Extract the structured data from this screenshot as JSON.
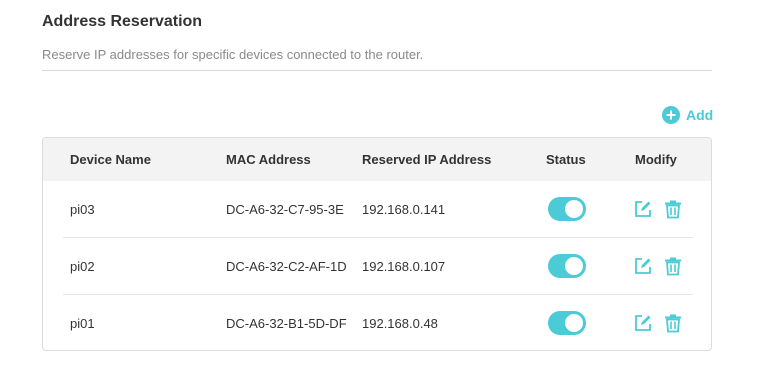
{
  "section": {
    "title": "Address Reservation",
    "description": "Reserve IP addresses for specific devices connected to the router."
  },
  "toolbar": {
    "add_label": "Add",
    "add_icon": "plus-circle-icon"
  },
  "colors": {
    "accent": "#4acbd6",
    "header_bg": "#f3f3f3"
  },
  "table": {
    "headers": {
      "device_name": "Device Name",
      "mac_address": "MAC Address",
      "reserved_ip": "Reserved IP Address",
      "status": "Status",
      "modify": "Modify"
    },
    "rows": [
      {
        "device_name": "pi03",
        "mac_address": "DC-A6-32-C7-95-3E",
        "reserved_ip": "192.168.0.141",
        "status_enabled": true
      },
      {
        "device_name": "pi02",
        "mac_address": "DC-A6-32-C2-AF-1D",
        "reserved_ip": "192.168.0.107",
        "status_enabled": true
      },
      {
        "device_name": "pi01",
        "mac_address": "DC-A6-32-B1-5D-DF",
        "reserved_ip": "192.168.0.48",
        "status_enabled": true
      }
    ],
    "row_icons": {
      "edit": "edit-icon",
      "delete": "trash-icon"
    }
  }
}
